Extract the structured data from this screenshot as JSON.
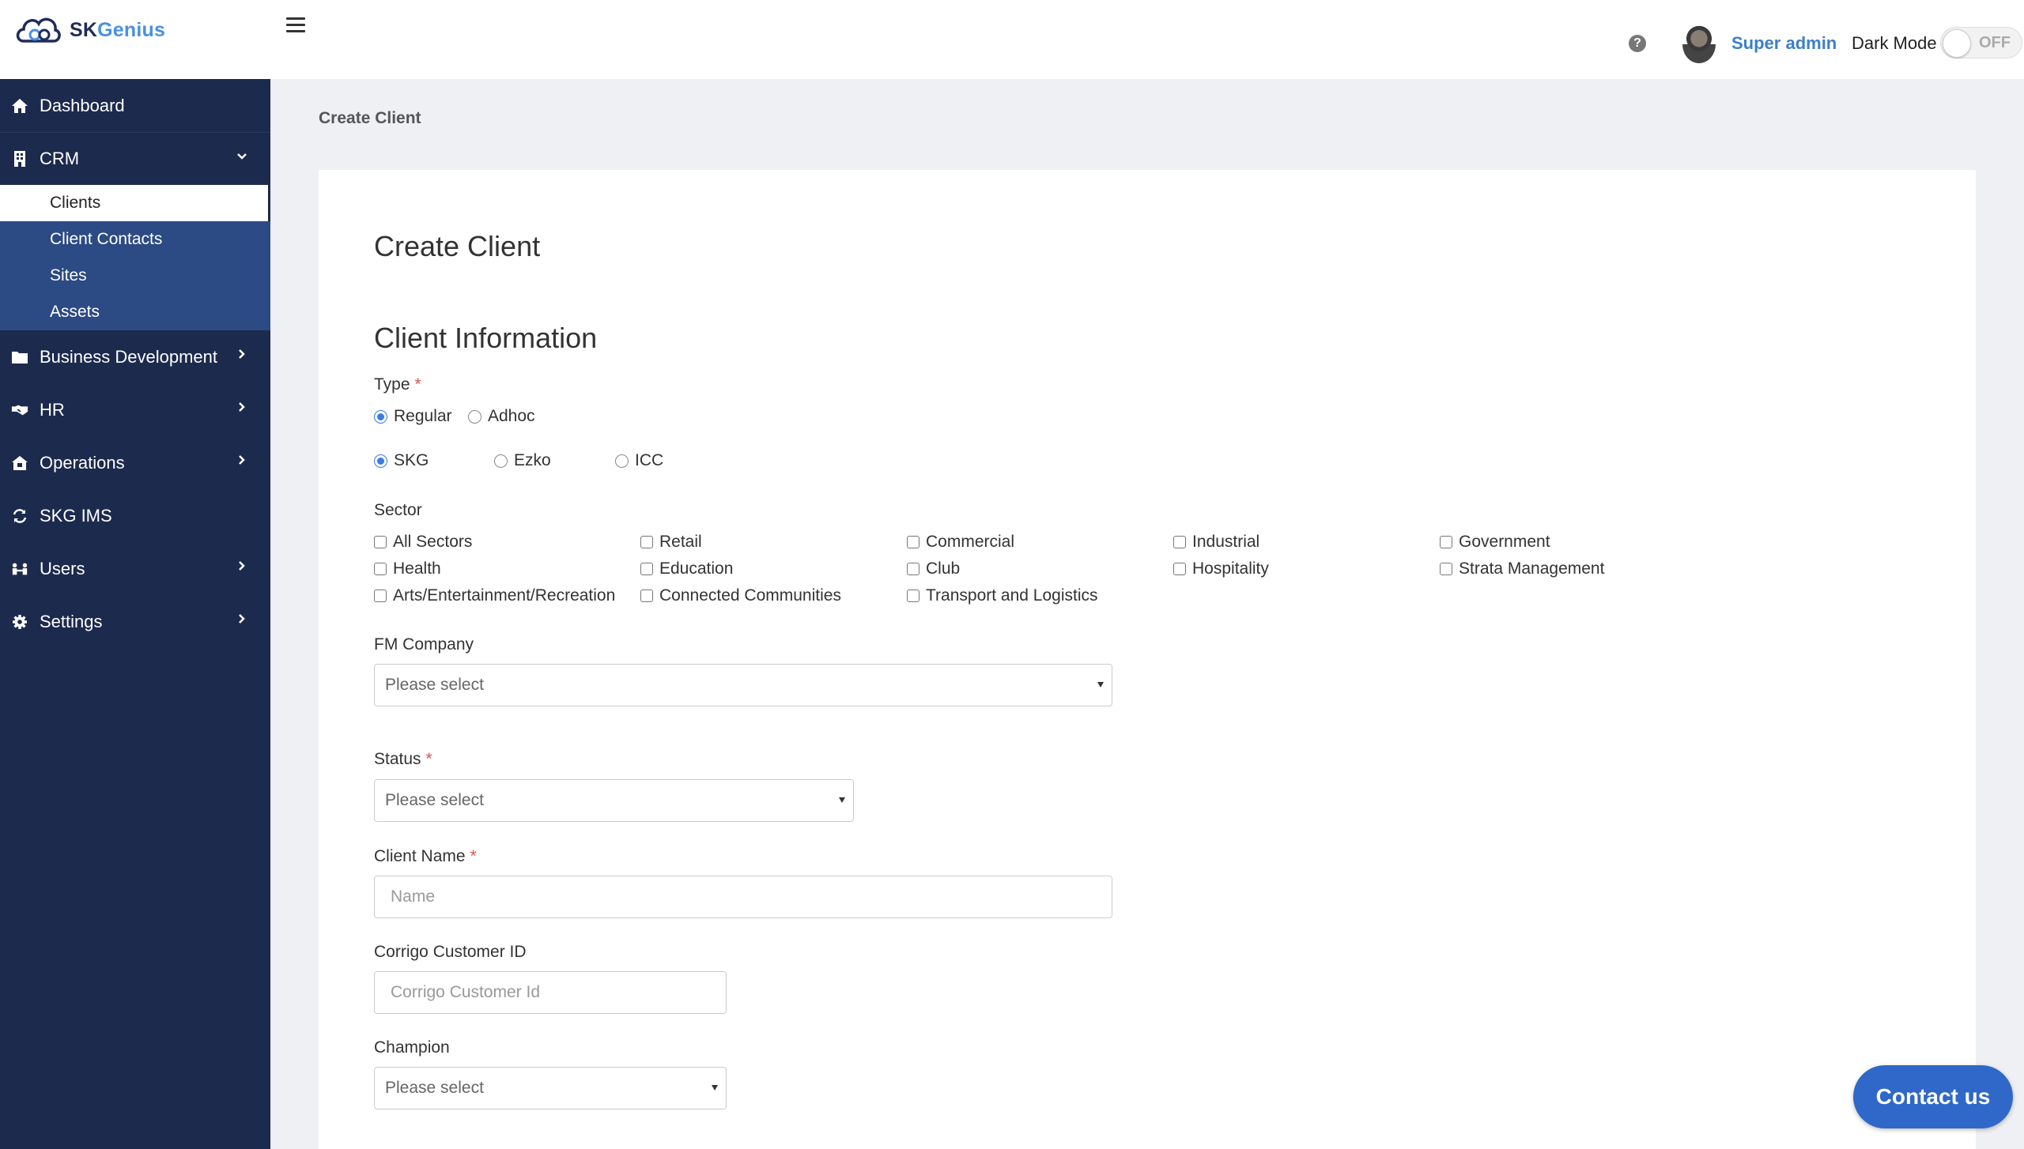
{
  "app": {
    "logo_sk": "SK",
    "logo_gen": "Genius"
  },
  "header": {
    "user_name": "Super admin",
    "dark_mode_label": "Dark Mode",
    "dark_mode_state": "OFF",
    "help_glyph": "?"
  },
  "sidebar": {
    "items": [
      {
        "label": "Dashboard",
        "icon": "home-icon"
      },
      {
        "label": "CRM",
        "icon": "building-icon",
        "expanded": true
      },
      {
        "label": "Business Development",
        "icon": "folder-icon"
      },
      {
        "label": "HR",
        "icon": "handshake-icon"
      },
      {
        "label": "Operations",
        "icon": "house-tools-icon"
      },
      {
        "label": "SKG IMS",
        "icon": "sync-icon"
      },
      {
        "label": "Users",
        "icon": "users-icon"
      },
      {
        "label": "Settings",
        "icon": "gear-icon"
      }
    ],
    "crm_sub": [
      "Clients",
      "Client Contacts",
      "Sites",
      "Assets"
    ],
    "active_sub": "Clients"
  },
  "breadcrumb": "Create Client",
  "form": {
    "title": "Create Client",
    "section": "Client Information",
    "type_label": "Type",
    "type_options": [
      "Regular",
      "Adhoc"
    ],
    "type_selected": "Regular",
    "company_options": [
      "SKG",
      "Ezko",
      "ICC"
    ],
    "company_selected": "SKG",
    "sector_label": "Sector",
    "sectors": [
      "All Sectors",
      "Retail",
      "Commercial",
      "Industrial",
      "Government",
      "Health",
      "Education",
      "Club",
      "Hospitality",
      "Strata Management",
      "Arts/Entertainment/Recreation",
      "Connected Communities",
      "Transport and Logistics"
    ],
    "fm_company_label": "FM Company",
    "fm_company_placeholder": "Please select",
    "status_label": "Status",
    "status_placeholder": "Please select",
    "client_name_label": "Client Name",
    "client_name_placeholder": "Name",
    "corrigo_label": "Corrigo Customer ID",
    "corrigo_placeholder": "Corrigo Customer Id",
    "champion_label": "Champion",
    "champion_placeholder": "Please select",
    "required_mark": "*"
  },
  "contact_button": "Contact us",
  "colors": {
    "sidebar_bg": "#1c2a4d",
    "sub_nav_bg": "#2c4a84",
    "accent": "#3d7be0",
    "contact_btn": "#2f68c8",
    "required": "#d9534f",
    "user_link": "#3c7fc9"
  }
}
